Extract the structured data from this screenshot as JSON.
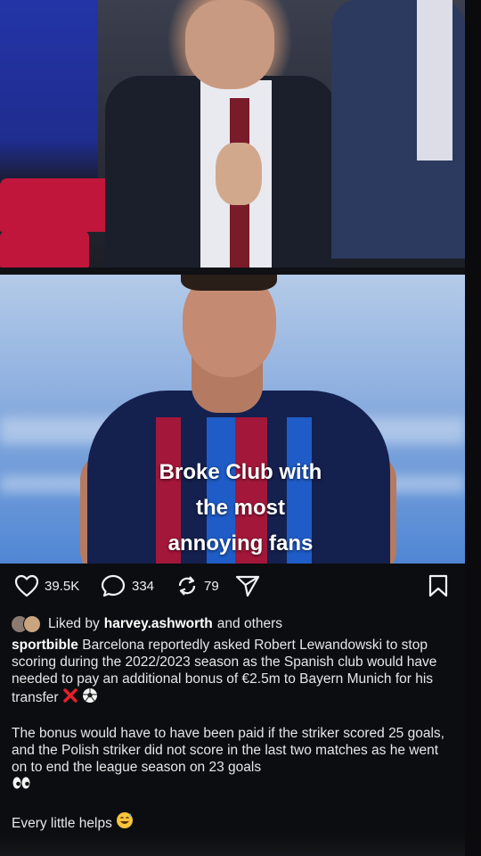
{
  "post_image": {
    "caption_lines": [
      "Broke Club with",
      "the most",
      "annoying fans"
    ]
  },
  "actions": {
    "likes": "39.5K",
    "comments": "334",
    "reposts": "79"
  },
  "liked_by": {
    "prefix": "Liked by",
    "user": "harvey.ashworth",
    "suffix": "and others"
  },
  "post": {
    "author": "sportbible",
    "paragraph1": "Barcelona reportedly asked Robert Lewandowski to stop scoring during the 2022/2023 season as the Spanish club would have needed to pay an additional bonus of €2.5m to Bayern Munich for his transfer",
    "paragraph2": "The bonus would have to have been paid if the striker scored 25 goals, and the Polish striker did not score in the last two matches as he went on to end the league season on 23 goals",
    "paragraph3": "Every little helps"
  },
  "colors": {
    "background": "#0c0d10",
    "text": "#e6e6e8",
    "accent_red": "#c0163b"
  }
}
